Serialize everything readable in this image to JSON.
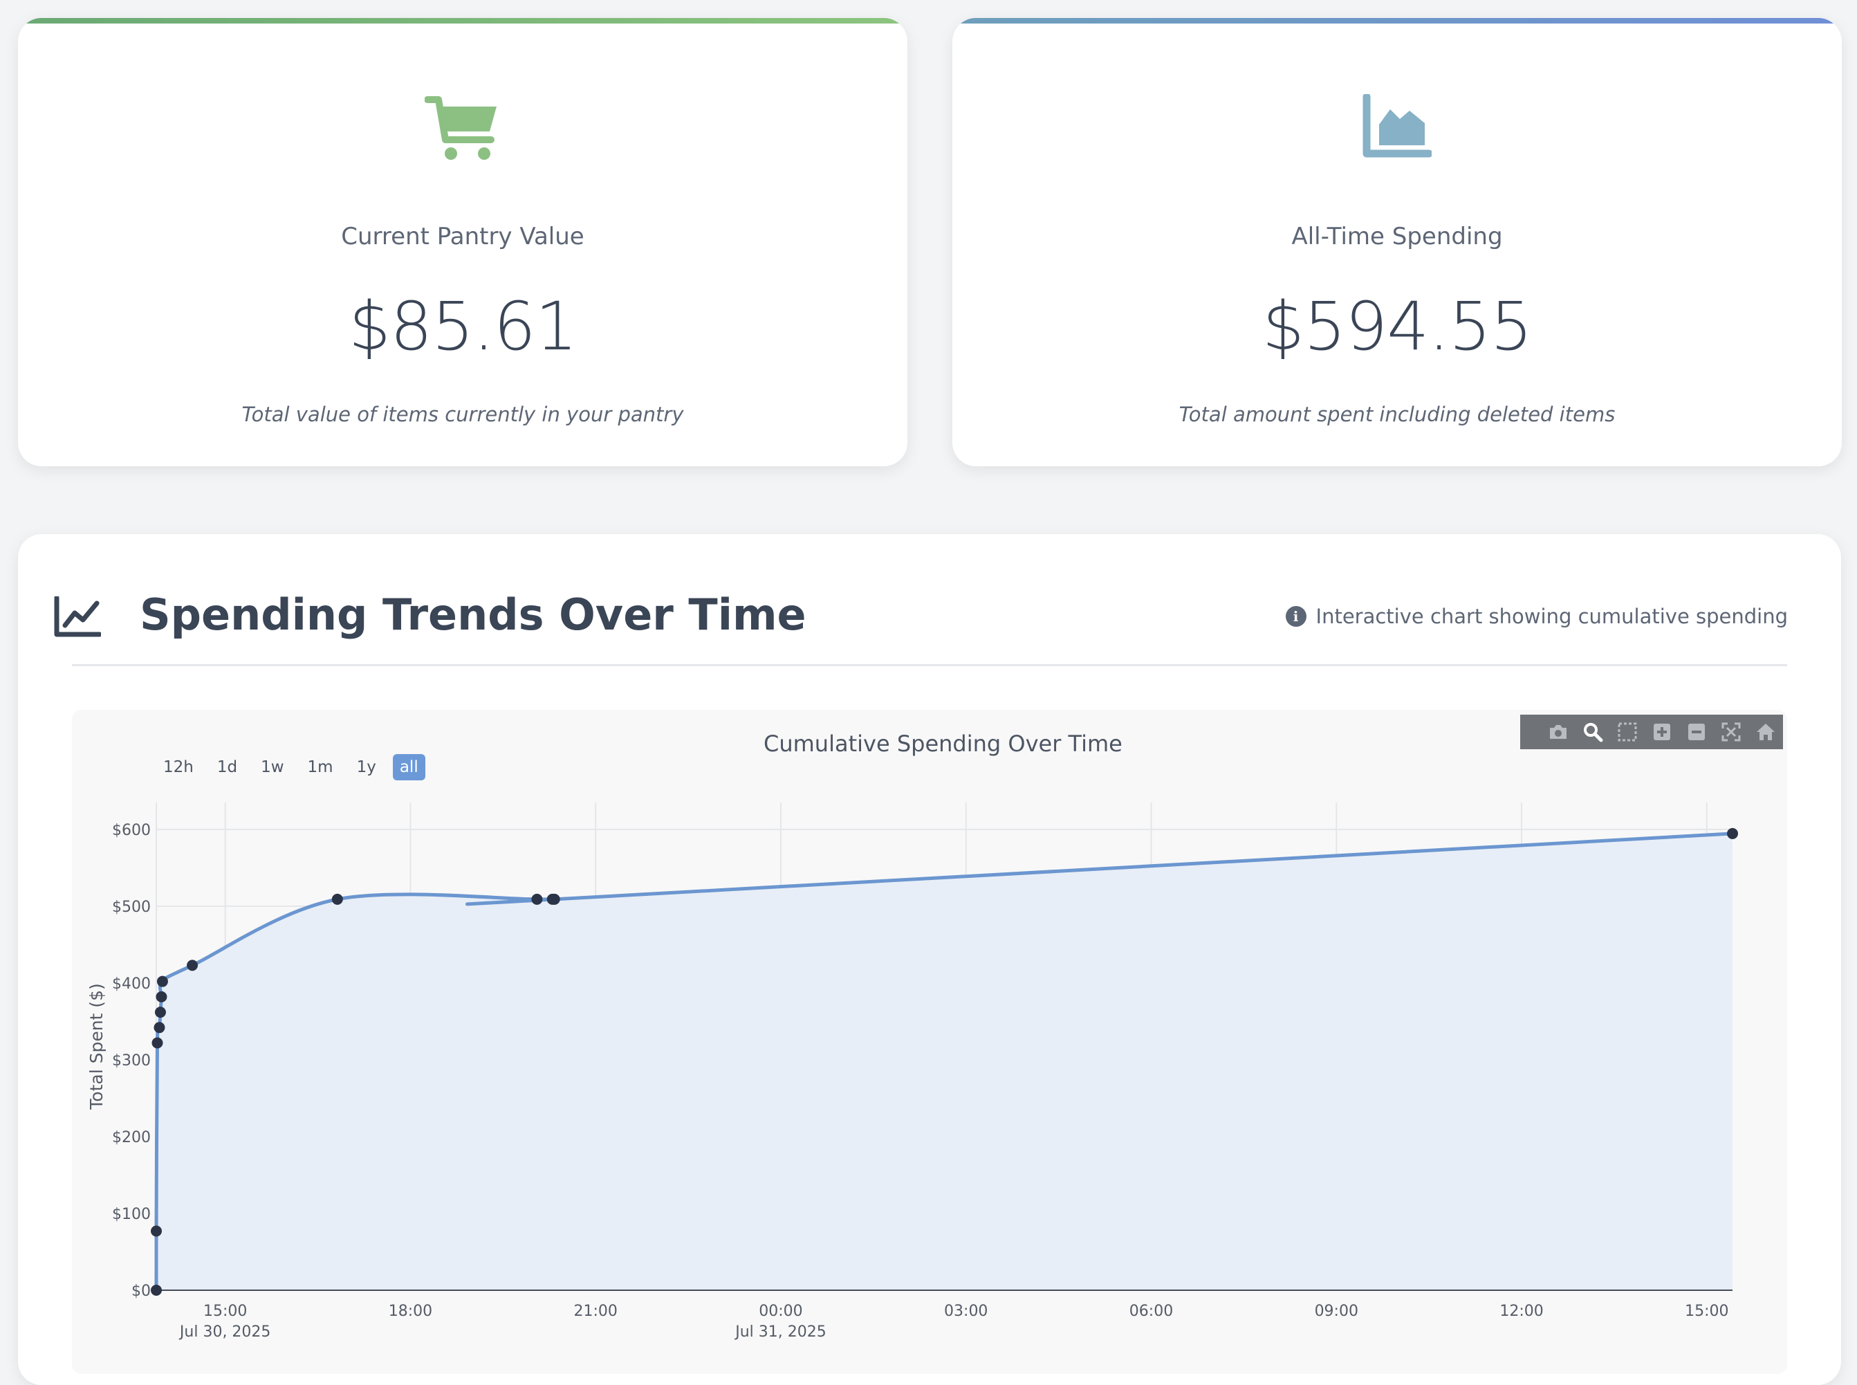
{
  "cards": [
    {
      "icon": "shopping-cart-icon",
      "title": "Current Pantry Value",
      "value": "$85.61",
      "subtitle": "Total value of items currently in your pantry",
      "accent": "#8cc083"
    },
    {
      "icon": "area-chart-icon",
      "title": "All-Time Spending",
      "value": "$594.55",
      "subtitle": "Total amount spent including deleted items",
      "accent": "#86b1c7"
    }
  ],
  "section": {
    "icon": "line-chart-icon",
    "title": "Spending Trends Over Time",
    "info_icon": "info-icon",
    "info_text": "Interactive chart showing cumulative spending"
  },
  "range_buttons": [
    "12h",
    "1d",
    "1w",
    "1m",
    "1y",
    "all"
  ],
  "active_range": "all",
  "modebar_icons": [
    "camera-icon",
    "zoom-icon",
    "box-select-icon",
    "zoom-in-icon",
    "zoom-out-icon",
    "autoscale-icon",
    "home-icon"
  ],
  "chart_data": {
    "type": "area",
    "title": "Cumulative Spending Over Time",
    "xlabel": "",
    "ylabel": "Total Spent ($)",
    "x_range": [
      "2025-07-30 13:53",
      "2025-07-31 15:25"
    ],
    "ylim": [
      0,
      635
    ],
    "y_ticks": [
      0,
      100,
      200,
      300,
      400,
      500,
      600
    ],
    "y_tick_labels": [
      "$0",
      "$100",
      "$200",
      "$300",
      "$400",
      "$500",
      "$600"
    ],
    "x_ticks": [
      "2025-07-30 15:00",
      "2025-07-30 18:00",
      "2025-07-30 21:00",
      "2025-07-31 00:00",
      "2025-07-31 03:00",
      "2025-07-31 06:00",
      "2025-07-31 09:00",
      "2025-07-31 12:00",
      "2025-07-31 15:00"
    ],
    "x_tick_labels": [
      "15:00",
      "18:00",
      "21:00",
      "00:00",
      "03:00",
      "06:00",
      "09:00",
      "12:00",
      "15:00"
    ],
    "x_tick_sublabels": [
      "Jul 30, 2025",
      "",
      "",
      "Jul 31, 2025",
      "",
      "",
      "",
      "",
      ""
    ],
    "grid": true,
    "line_color": "#6b96d0",
    "marker_color": "#2b3447",
    "fill_color": "#e8eef7",
    "series": [
      {
        "x": [
          "2025-07-30 13:53",
          "2025-07-30 13:53",
          "2025-07-30 13:54",
          "2025-07-30 13:56",
          "2025-07-30 13:57",
          "2025-07-30 13:58",
          "2025-07-30 13:59",
          "2025-07-30 14:28",
          "2025-07-30 16:49",
          "2025-07-30 20:03",
          "2025-07-30 20:18",
          "2025-07-30 20:20",
          "2025-07-31 15:25"
        ],
        "y": [
          0,
          77,
          322,
          342,
          362,
          382,
          402,
          423,
          509,
          509,
          509,
          509,
          594.55
        ]
      }
    ]
  }
}
